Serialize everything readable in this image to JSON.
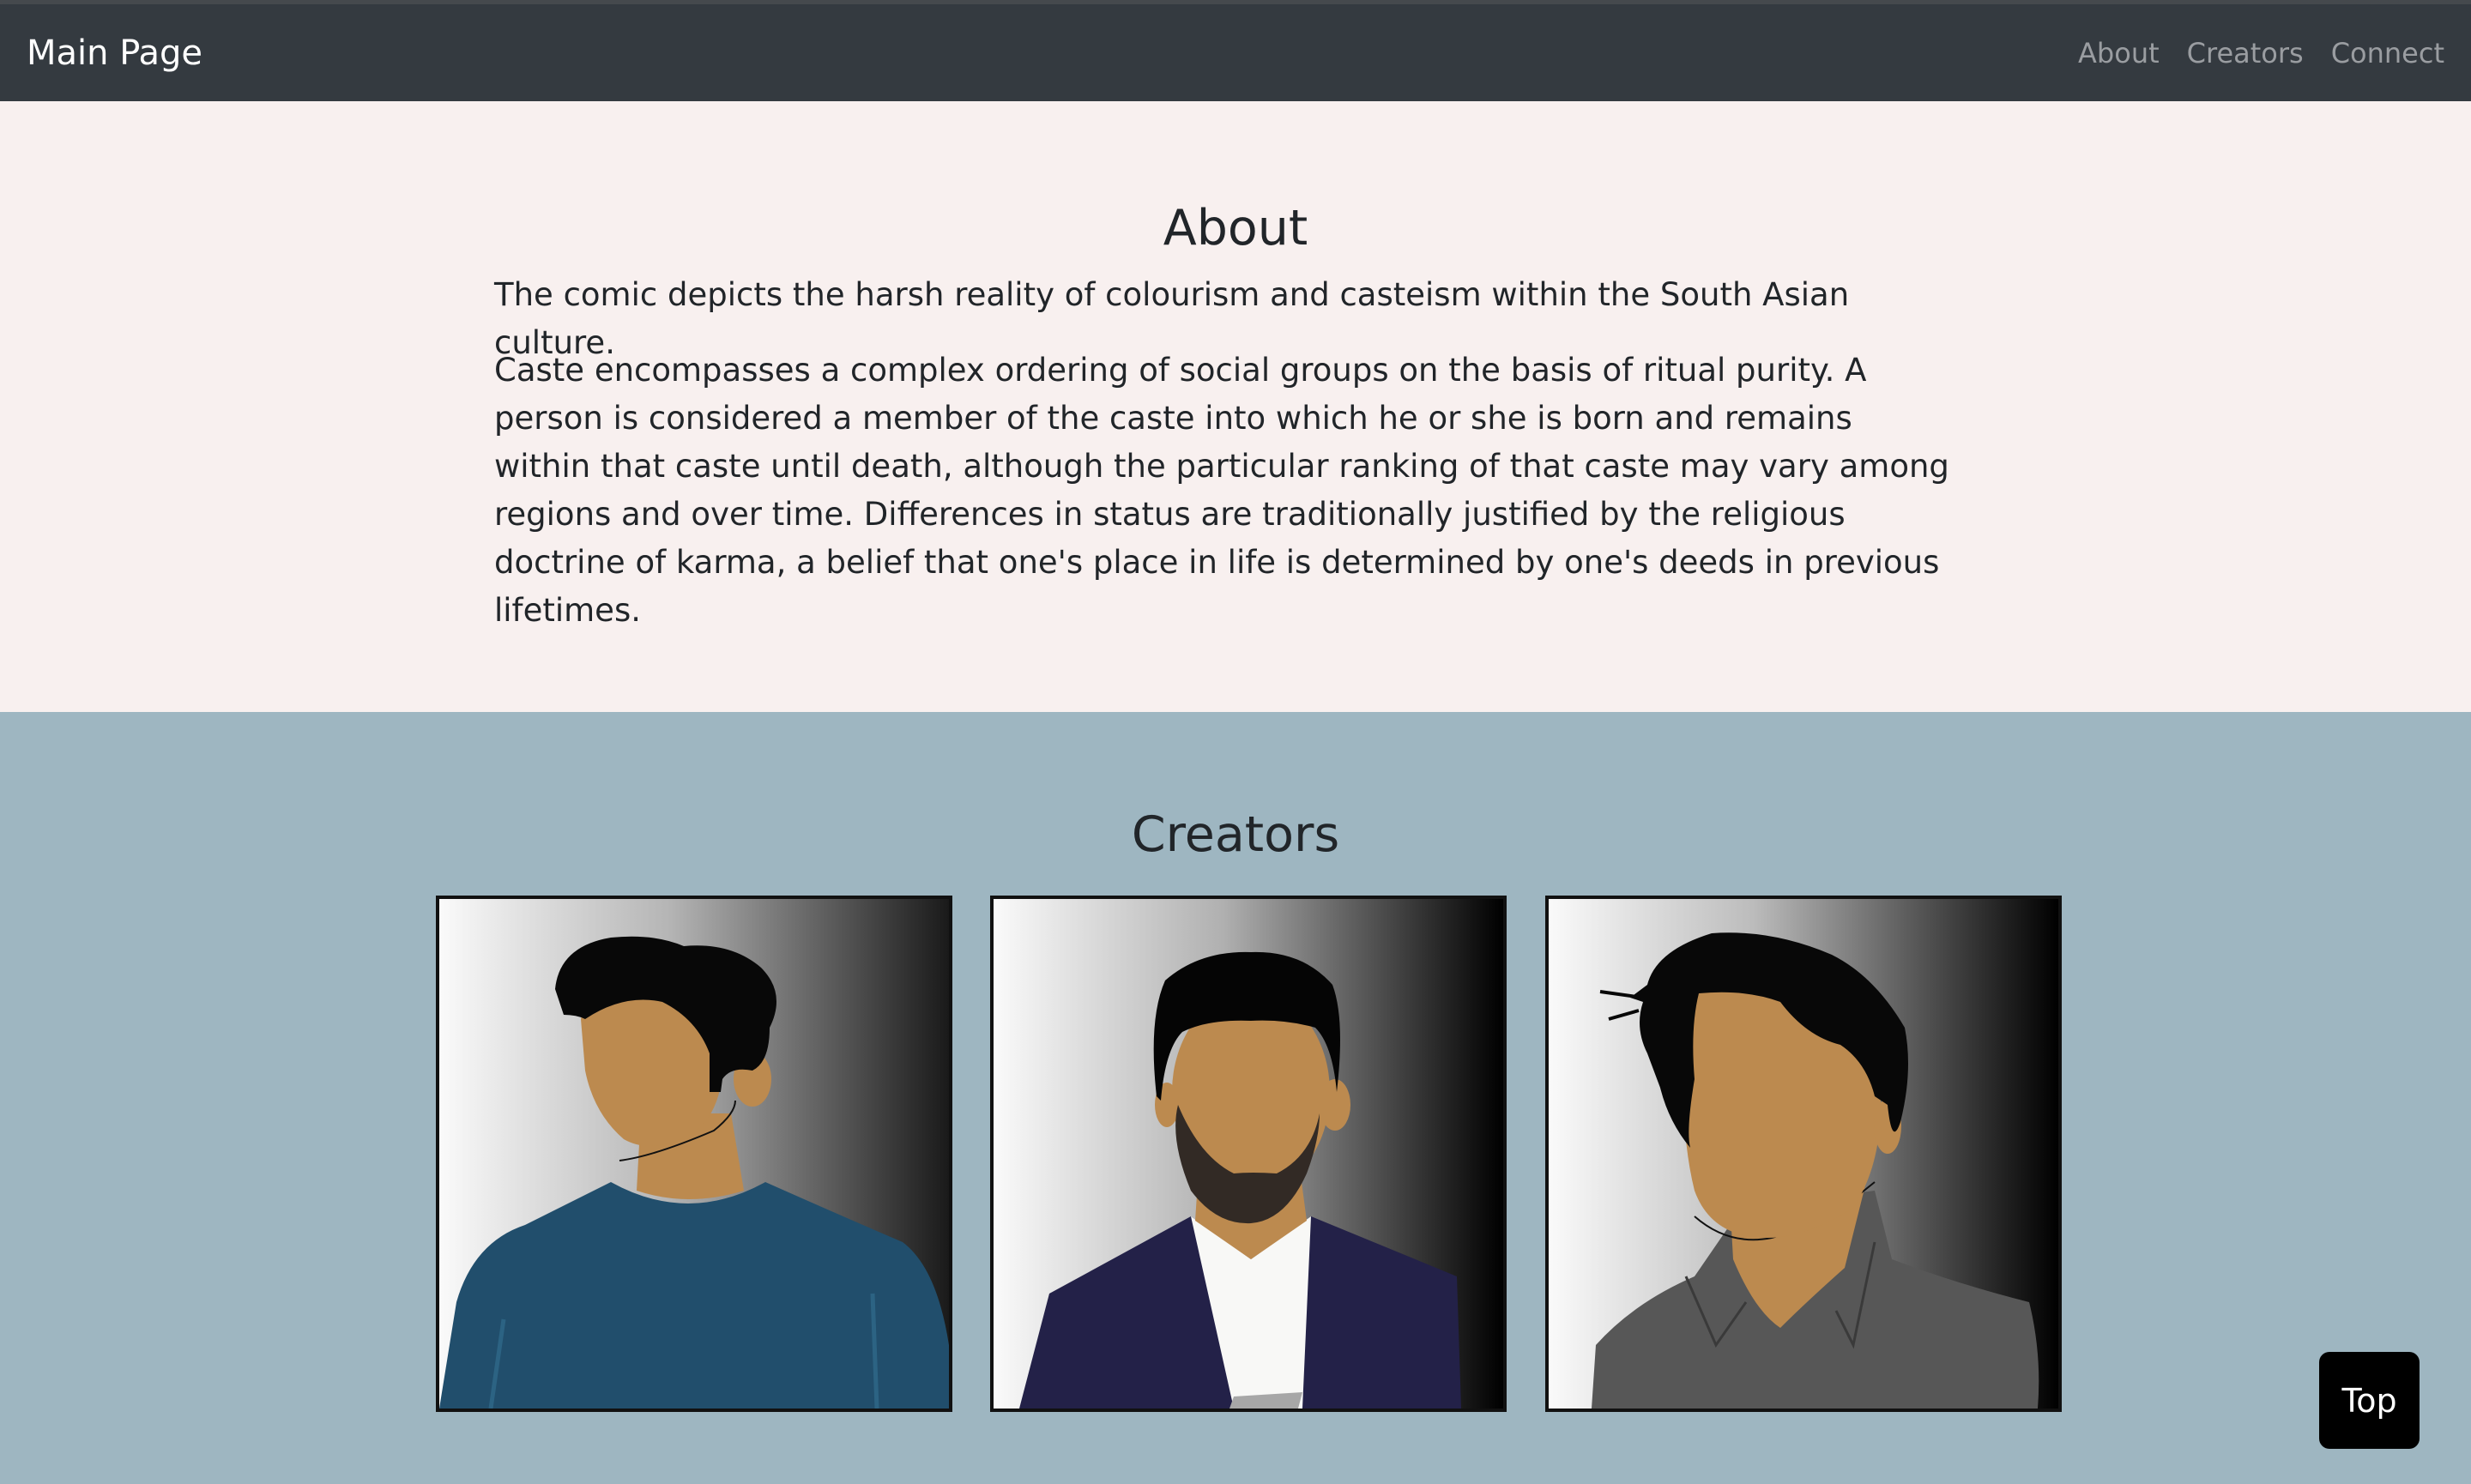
{
  "navbar": {
    "brand": "Main Page",
    "links": [
      "About",
      "Creators",
      "Connect"
    ]
  },
  "about": {
    "heading": "About",
    "paragraph1": "The comic depicts the harsh reality of colourism and casteism within the South Asian culture.",
    "paragraph2": "Caste encompasses a complex ordering of social groups on the basis of ritual purity. A person is considered a member of the caste into which he or she is born and remains within that caste until death, although the particular ranking of that caste may vary among regions and over time. Differences in status are traditionally justified by the religious doctrine of karma, a belief that one's place in life is determined by one's deeds in previous lifetimes."
  },
  "creators": {
    "heading": "Creators",
    "portraits": [
      {
        "icon": "creator-portrait-blue-sweater"
      },
      {
        "icon": "creator-portrait-navy-suit"
      },
      {
        "icon": "creator-portrait-gray-shirt"
      }
    ]
  },
  "top_button": {
    "label": "Top"
  },
  "colors": {
    "navbar_bg": "#343a40",
    "about_bg": "#f8f0ef",
    "creators_bg": "#9eb6c1",
    "skin": "#bc8a4f"
  }
}
